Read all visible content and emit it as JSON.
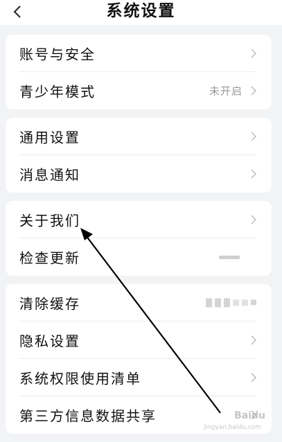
{
  "header": {
    "title": "系统设置",
    "back_icon": "chevron-left-icon"
  },
  "groups": [
    {
      "items": [
        {
          "label": "账号与安全",
          "value": ""
        },
        {
          "label": "青少年模式",
          "value": "未开启"
        }
      ]
    },
    {
      "items": [
        {
          "label": "通用设置",
          "value": ""
        },
        {
          "label": "消息通知",
          "value": ""
        }
      ]
    },
    {
      "items": [
        {
          "label": "关于我们",
          "value": ""
        },
        {
          "label": "检查更新",
          "value": ""
        }
      ]
    },
    {
      "items": [
        {
          "label": "清除缓存",
          "value": ""
        },
        {
          "label": "隐私设置",
          "value": ""
        },
        {
          "label": "系统权限使用清单",
          "value": ""
        },
        {
          "label": "第三方信息数据共享",
          "value": ""
        }
      ]
    }
  ],
  "annotation": {
    "type": "arrow",
    "color": "#000000",
    "points_to": "关于我们"
  },
  "watermark": {
    "text": "Baidu",
    "subtext": "jingyan.baidu.com"
  }
}
